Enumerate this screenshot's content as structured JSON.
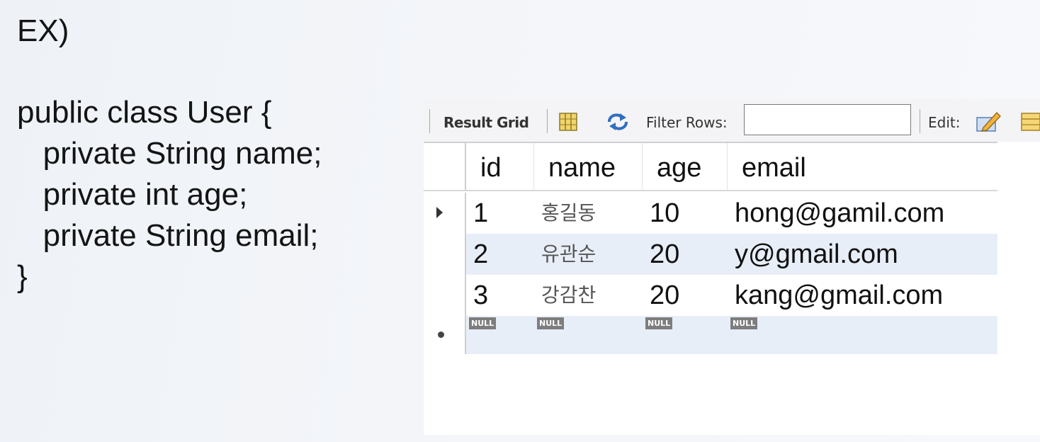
{
  "slide": {
    "heading": "EX)",
    "code_lines": [
      "public class User {",
      "   private String name;",
      "   private int age;",
      "   private String email;",
      "}"
    ]
  },
  "toolbar": {
    "result_grid_label": "Result Grid",
    "filter_rows_label": "Filter Rows:",
    "filter_value": "",
    "edit_label": "Edit:",
    "icons": [
      "grid-layout-icon",
      "refresh-icon",
      "edit-pencil-icon",
      "table-icon"
    ]
  },
  "grid": {
    "columns": [
      "id",
      "name",
      "age",
      "email"
    ],
    "rows": [
      [
        "1",
        "홍길동",
        "10",
        "hong@gamil.com"
      ],
      [
        "2",
        "유관순",
        "20",
        "y@gmail.com"
      ],
      [
        "3",
        "강감찬",
        "20",
        "kang@gmail.com"
      ]
    ],
    "new_row_placeholder": "NULL"
  }
}
